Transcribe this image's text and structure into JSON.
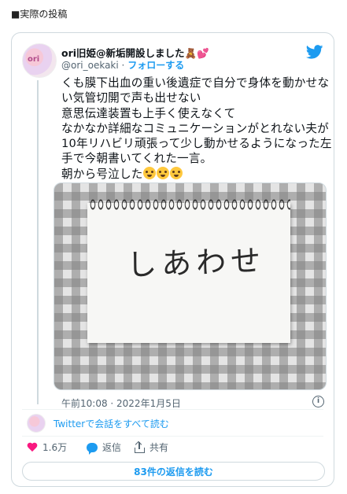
{
  "caption": "■実際の投稿",
  "tweet": {
    "display_name": "ori旧姫@新垢開設しました🧸💕",
    "handle": "@ori_oekaki",
    "separator": "·",
    "follow_label": "フォローする",
    "body": "くも膜下出血の重い後遺症で自分で身体を動かせない気管切開で声も出せない\n意思伝達装置も上手く使えなくて\nなかなか詳細なコミュニケーションがとれない夫が10年リハビリ頑張って少し動かせるようになった左手で今朝書いてくれた一言。\n朝から号泣した",
    "emoji_icons": [
      "loudly-crying-face-icon",
      "loudly-crying-face-icon",
      "loudly-crying-face-icon"
    ],
    "photo_handwriting": "しあわせ",
    "timestamp": "午前10:08 · 2022年1月5日",
    "info_icon": "info-icon"
  },
  "read_conversation": "Twitterで会話をすべて読む",
  "actions": {
    "likes": "1.6万",
    "reply_label": "返信",
    "share_label": "共有"
  },
  "replies_button": "83件の返信を読む",
  "colors": {
    "accent": "#1d9bf0",
    "like": "#f91880",
    "muted": "#536471",
    "border": "#cfd9de"
  }
}
